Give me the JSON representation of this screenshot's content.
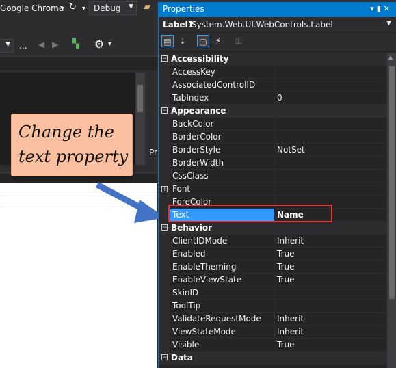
{
  "toolbar": {
    "browser": "Google Chrome",
    "config": "Debug",
    "more": "..."
  },
  "left": {
    "tab_fragment": "Pr"
  },
  "callout": {
    "line1": "Change the",
    "line2": "text property"
  },
  "properties": {
    "title": "Properties",
    "object_name": "Label1",
    "object_type": "System.Web.UI.WebControls.Label",
    "categories": {
      "accessibility": "Accessibility",
      "appearance": "Appearance",
      "behavior": "Behavior",
      "data": "Data"
    },
    "rows": {
      "access_key": {
        "name": "AccessKey",
        "value": ""
      },
      "associated_control_id": {
        "name": "AssociatedControlID",
        "value": ""
      },
      "tab_index": {
        "name": "TabIndex",
        "value": "0"
      },
      "back_color": {
        "name": "BackColor",
        "value": ""
      },
      "border_color": {
        "name": "BorderColor",
        "value": ""
      },
      "border_style": {
        "name": "BorderStyle",
        "value": "NotSet"
      },
      "border_width": {
        "name": "BorderWidth",
        "value": ""
      },
      "css_class": {
        "name": "CssClass",
        "value": ""
      },
      "font": {
        "name": "Font",
        "value": ""
      },
      "fore_color": {
        "name": "ForeColor",
        "value": ""
      },
      "text": {
        "name": "Text",
        "value": "Name"
      },
      "client_id_mode": {
        "name": "ClientIDMode",
        "value": "Inherit"
      },
      "enabled": {
        "name": "Enabled",
        "value": "True"
      },
      "enable_theming": {
        "name": "EnableTheming",
        "value": "True"
      },
      "enable_view_state": {
        "name": "EnableViewState",
        "value": "True"
      },
      "skin_id": {
        "name": "SkinID",
        "value": ""
      },
      "tool_tip": {
        "name": "ToolTip",
        "value": ""
      },
      "validate_request_mode": {
        "name": "ValidateRequestMode",
        "value": "Inherit"
      },
      "view_state_mode": {
        "name": "ViewStateMode",
        "value": "Inherit"
      },
      "visible": {
        "name": "Visible",
        "value": "True"
      }
    }
  },
  "colors": {
    "accent": "#007acc",
    "selection": "#3399ff",
    "highlight_box": "#e0393e",
    "callout_fill": "#fac0a0",
    "callout_arrow": "#4472c4"
  }
}
